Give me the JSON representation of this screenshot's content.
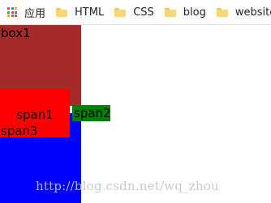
{
  "bookmarks": {
    "apps_label": "应用",
    "items": [
      {
        "label": "HTML"
      },
      {
        "label": "CSS"
      },
      {
        "label": "blog"
      },
      {
        "label": "website"
      }
    ]
  },
  "demo": {
    "box1": {
      "label": "box1",
      "color": "#a52a2a"
    },
    "span1": {
      "label": "span1",
      "color": "#ff0000"
    },
    "span2": {
      "label": "span2",
      "color": "#008000"
    },
    "span3": {
      "label": "span3"
    },
    "box3": {
      "color": "#0000ff"
    }
  },
  "watermark": "http://blog.csdn.net/wq_zhou"
}
